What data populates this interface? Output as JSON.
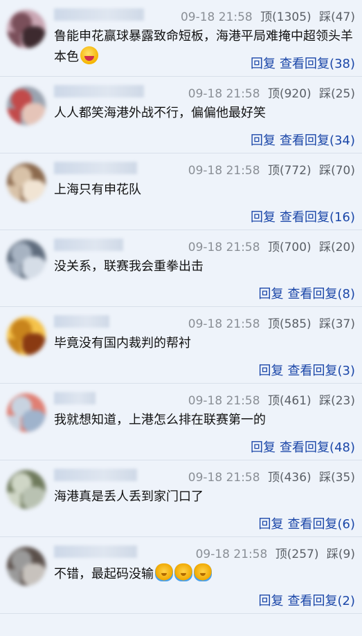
{
  "labels": {
    "up": "顶",
    "down": "踩",
    "reply": "回复",
    "view_replies": "查看回复"
  },
  "comments": [
    {
      "time": "09-18 21:58",
      "up": "(1305)",
      "down": "(47)",
      "text": "鲁能申花赢球暴露致命短板，海港平局难掩中超领头羊本色",
      "emoji": [
        "happy-face-icon"
      ],
      "replies": "(38)"
    },
    {
      "time": "09-18 21:58",
      "up": "(920)",
      "down": "(25)",
      "text": "人人都笑海港外战不行，偏偏他最好笑",
      "emoji": [],
      "replies": "(34)"
    },
    {
      "time": "09-18 21:58",
      "up": "(772)",
      "down": "(70)",
      "text": "上海只有申花队",
      "emoji": [],
      "replies": "(16)"
    },
    {
      "time": "09-18 21:58",
      "up": "(700)",
      "down": "(20)",
      "text": "没关系，联赛我会重拳出击",
      "emoji": [],
      "replies": "(8)"
    },
    {
      "time": "09-18 21:58",
      "up": "(585)",
      "down": "(37)",
      "text": "毕竟没有国内裁判的帮衬",
      "emoji": [],
      "replies": "(3)"
    },
    {
      "time": "09-18 21:58",
      "up": "(461)",
      "down": "(23)",
      "text": "我就想知道，上港怎么排在联赛第一的",
      "emoji": [],
      "replies": "(48)"
    },
    {
      "time": "09-18 21:58",
      "up": "(436)",
      "down": "(35)",
      "text": "海港真是丢人丢到家门口了",
      "emoji": [],
      "replies": "(6)"
    },
    {
      "time": "09-18 21:58",
      "up": "(257)",
      "down": "(9)",
      "text": "不错，最起码没输",
      "emoji": [
        "baby-emoji-icon",
        "baby-emoji-icon",
        "baby-emoji-icon"
      ],
      "replies": "(2)"
    }
  ],
  "avatar_colors": [
    [
      "#7a4f5a",
      "#c9a6b3",
      "#3d2a2f"
    ],
    [
      "#c24a4a",
      "#9aa3b0",
      "#e5c4b8"
    ],
    [
      "#d8c2a8",
      "#8c6a4e",
      "#f1e4d3"
    ],
    [
      "#a7b3c2",
      "#5f6c7d",
      "#d5dde7"
    ],
    [
      "#c8841c",
      "#f4c24a",
      "#8a3a12"
    ],
    [
      "#c8d3e0",
      "#e07f73",
      "#9fb3cc"
    ],
    [
      "#cfd6c6",
      "#6f7a5c",
      "#b9c2b2"
    ],
    [
      "#9a9a9a",
      "#5a4f4a",
      "#c7c2bd"
    ]
  ],
  "username_widths": [
    130,
    130,
    120,
    100,
    80,
    60,
    120,
    120
  ],
  "theme": {
    "link": "#1a46a8",
    "time": "#8a8f96",
    "background": "#eef3fa"
  }
}
